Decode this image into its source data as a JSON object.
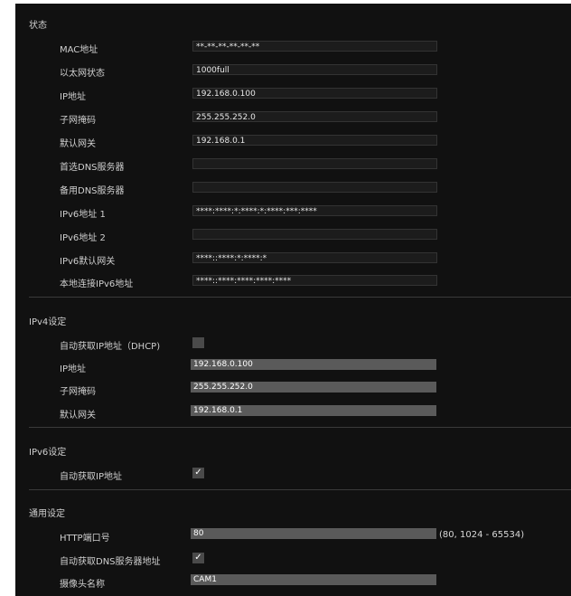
{
  "status": {
    "title": "状态",
    "rows": [
      {
        "label": "MAC地址",
        "value": "**-**-**-**-**-**"
      },
      {
        "label": "以太网状态",
        "value": "1000full"
      },
      {
        "label": "IP地址",
        "value": "192.168.0.100"
      },
      {
        "label": "子网掩码",
        "value": "255.255.252.0"
      },
      {
        "label": "默认网关",
        "value": "192.168.0.1"
      },
      {
        "label": "首选DNS服务器",
        "value": ""
      },
      {
        "label": "备用DNS服务器",
        "value": ""
      },
      {
        "label": "IPv6地址 1",
        "value": "****:****:*:****:*:****:***:****"
      },
      {
        "label": "IPv6地址 2",
        "value": ""
      },
      {
        "label": "IPv6默认网关",
        "value": "****::****:*:****:*"
      },
      {
        "label": "本地连接IPv6地址",
        "value": "****::****:****:****:****"
      }
    ]
  },
  "ipv4": {
    "title": "IPv4设定",
    "dhcp_label": "自动获取IP地址（DHCP)",
    "dhcp_checked": false,
    "ip_label": "IP地址",
    "ip_value": "192.168.0.100",
    "mask_label": "子网掩码",
    "mask_value": "255.255.252.0",
    "gateway_label": "默认网关",
    "gateway_value": "192.168.0.1"
  },
  "ipv6": {
    "title": "IPv6设定",
    "auto_label": "自动获取IP地址",
    "auto_checked": true,
    "check_mark": "✓"
  },
  "general": {
    "title": "通用设定",
    "http_port_label": "HTTP端口号",
    "http_port_value": "80",
    "http_port_range": "(80, 1024 - 65534)",
    "auto_dns_label": "自动获取DNS服务器地址",
    "auto_dns_checked": true,
    "check_mark": "✓",
    "camera_name_label": "摄像头名称",
    "camera_name_value": "CAM1"
  }
}
